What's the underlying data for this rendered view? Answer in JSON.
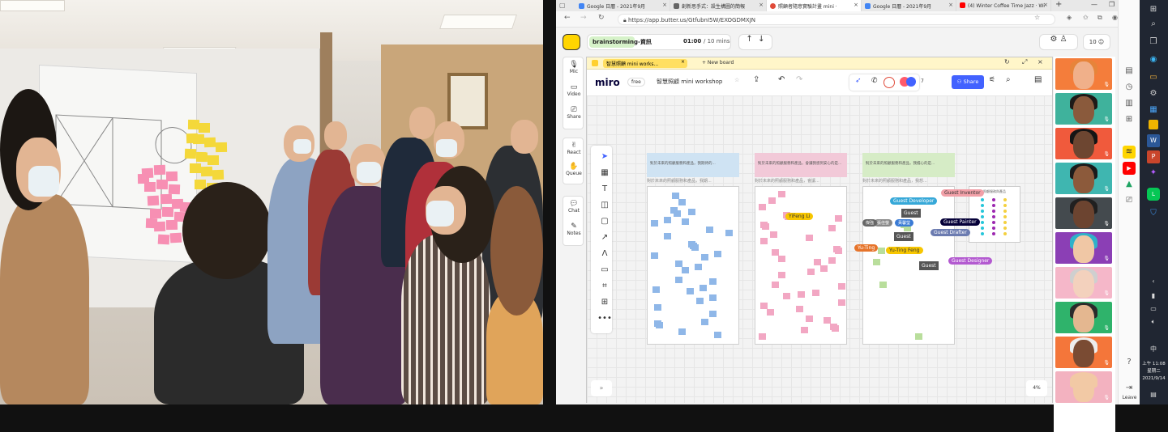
{
  "browser": {
    "tabs": [
      {
        "label": "Google 日曆 - 2021年9月",
        "color": "#4285f4"
      },
      {
        "label": "創新思手式：設生構圖的簡報",
        "color": "#666666"
      },
      {
        "label": "照顧者隨意實驗計畫 mini ·",
        "color": "#e04b3a"
      },
      {
        "label": "Google 日曆 - 2021年9月",
        "color": "#4285f4"
      },
      {
        "label": "(4) Winter Coffee Time Jazz · Wi",
        "color": "#ff0000"
      }
    ],
    "new_tab_icon": "plus-icon",
    "url": "https://app.butter.us/GtfubnI5W/EXOGDMXJN"
  },
  "butter": {
    "room_name": "brainstorming-資訊",
    "timer": "01:00",
    "timer_total": "/ 10 mins",
    "participants_count": "10",
    "tools": [
      {
        "icon": "mic-icon",
        "label": "Mic"
      },
      {
        "icon": "video-icon",
        "label": "Video"
      },
      {
        "icon": "share-screen-icon",
        "label": "Share"
      },
      {
        "icon": "react-icon",
        "label": "React"
      },
      {
        "icon": "queue-icon",
        "label": "Queue"
      },
      {
        "icon": "chat-icon",
        "label": "Chat"
      },
      {
        "icon": "notes-icon",
        "label": "Notes"
      }
    ],
    "frame_tab": "智慧照顧 mini works...",
    "new_board": "+ New board",
    "leave": "Leave"
  },
  "miro": {
    "logo": "miro",
    "plan": "free",
    "board_title": "智慧照顧 mini workshop",
    "collab_count": "7",
    "share_label": "Share",
    "zoom": "4%",
    "columns": [
      {
        "header": "對於未來的照顧服務和產品，我期待的...",
        "title": "對於未來的照顧服務和產品，我期...",
        "color": "#cfe3f3"
      },
      {
        "header": "對於未來的照顧服務和產品，會讓我感到安心的是...",
        "title": "對於未來的照顧服務和產品，會讓...",
        "color": "#f2c9d8"
      },
      {
        "header": "對於未來的照顧服務和產品，我擔心的是...",
        "title": "對於未來的照顧服務和產品，我想...",
        "color": "#d6ecc6"
      }
    ],
    "side_panel_title": "照顧服務與產品",
    "cursors": [
      "YiFeng Li",
      "Yu-Ting",
      "Yu-Ting Feng",
      "Guest Developer",
      "Guest Inventor",
      "Guest Painter",
      "Guest Drafter",
      "Guest Designer",
      "Guest",
      "Guest",
      "Guest",
      "張佳螢",
      "黃馨瑩",
      "傑強"
    ]
  },
  "taskbar": {
    "time": "上午 11:08",
    "weekday": "星期二",
    "date": "2021/9/14",
    "ime": "中"
  }
}
